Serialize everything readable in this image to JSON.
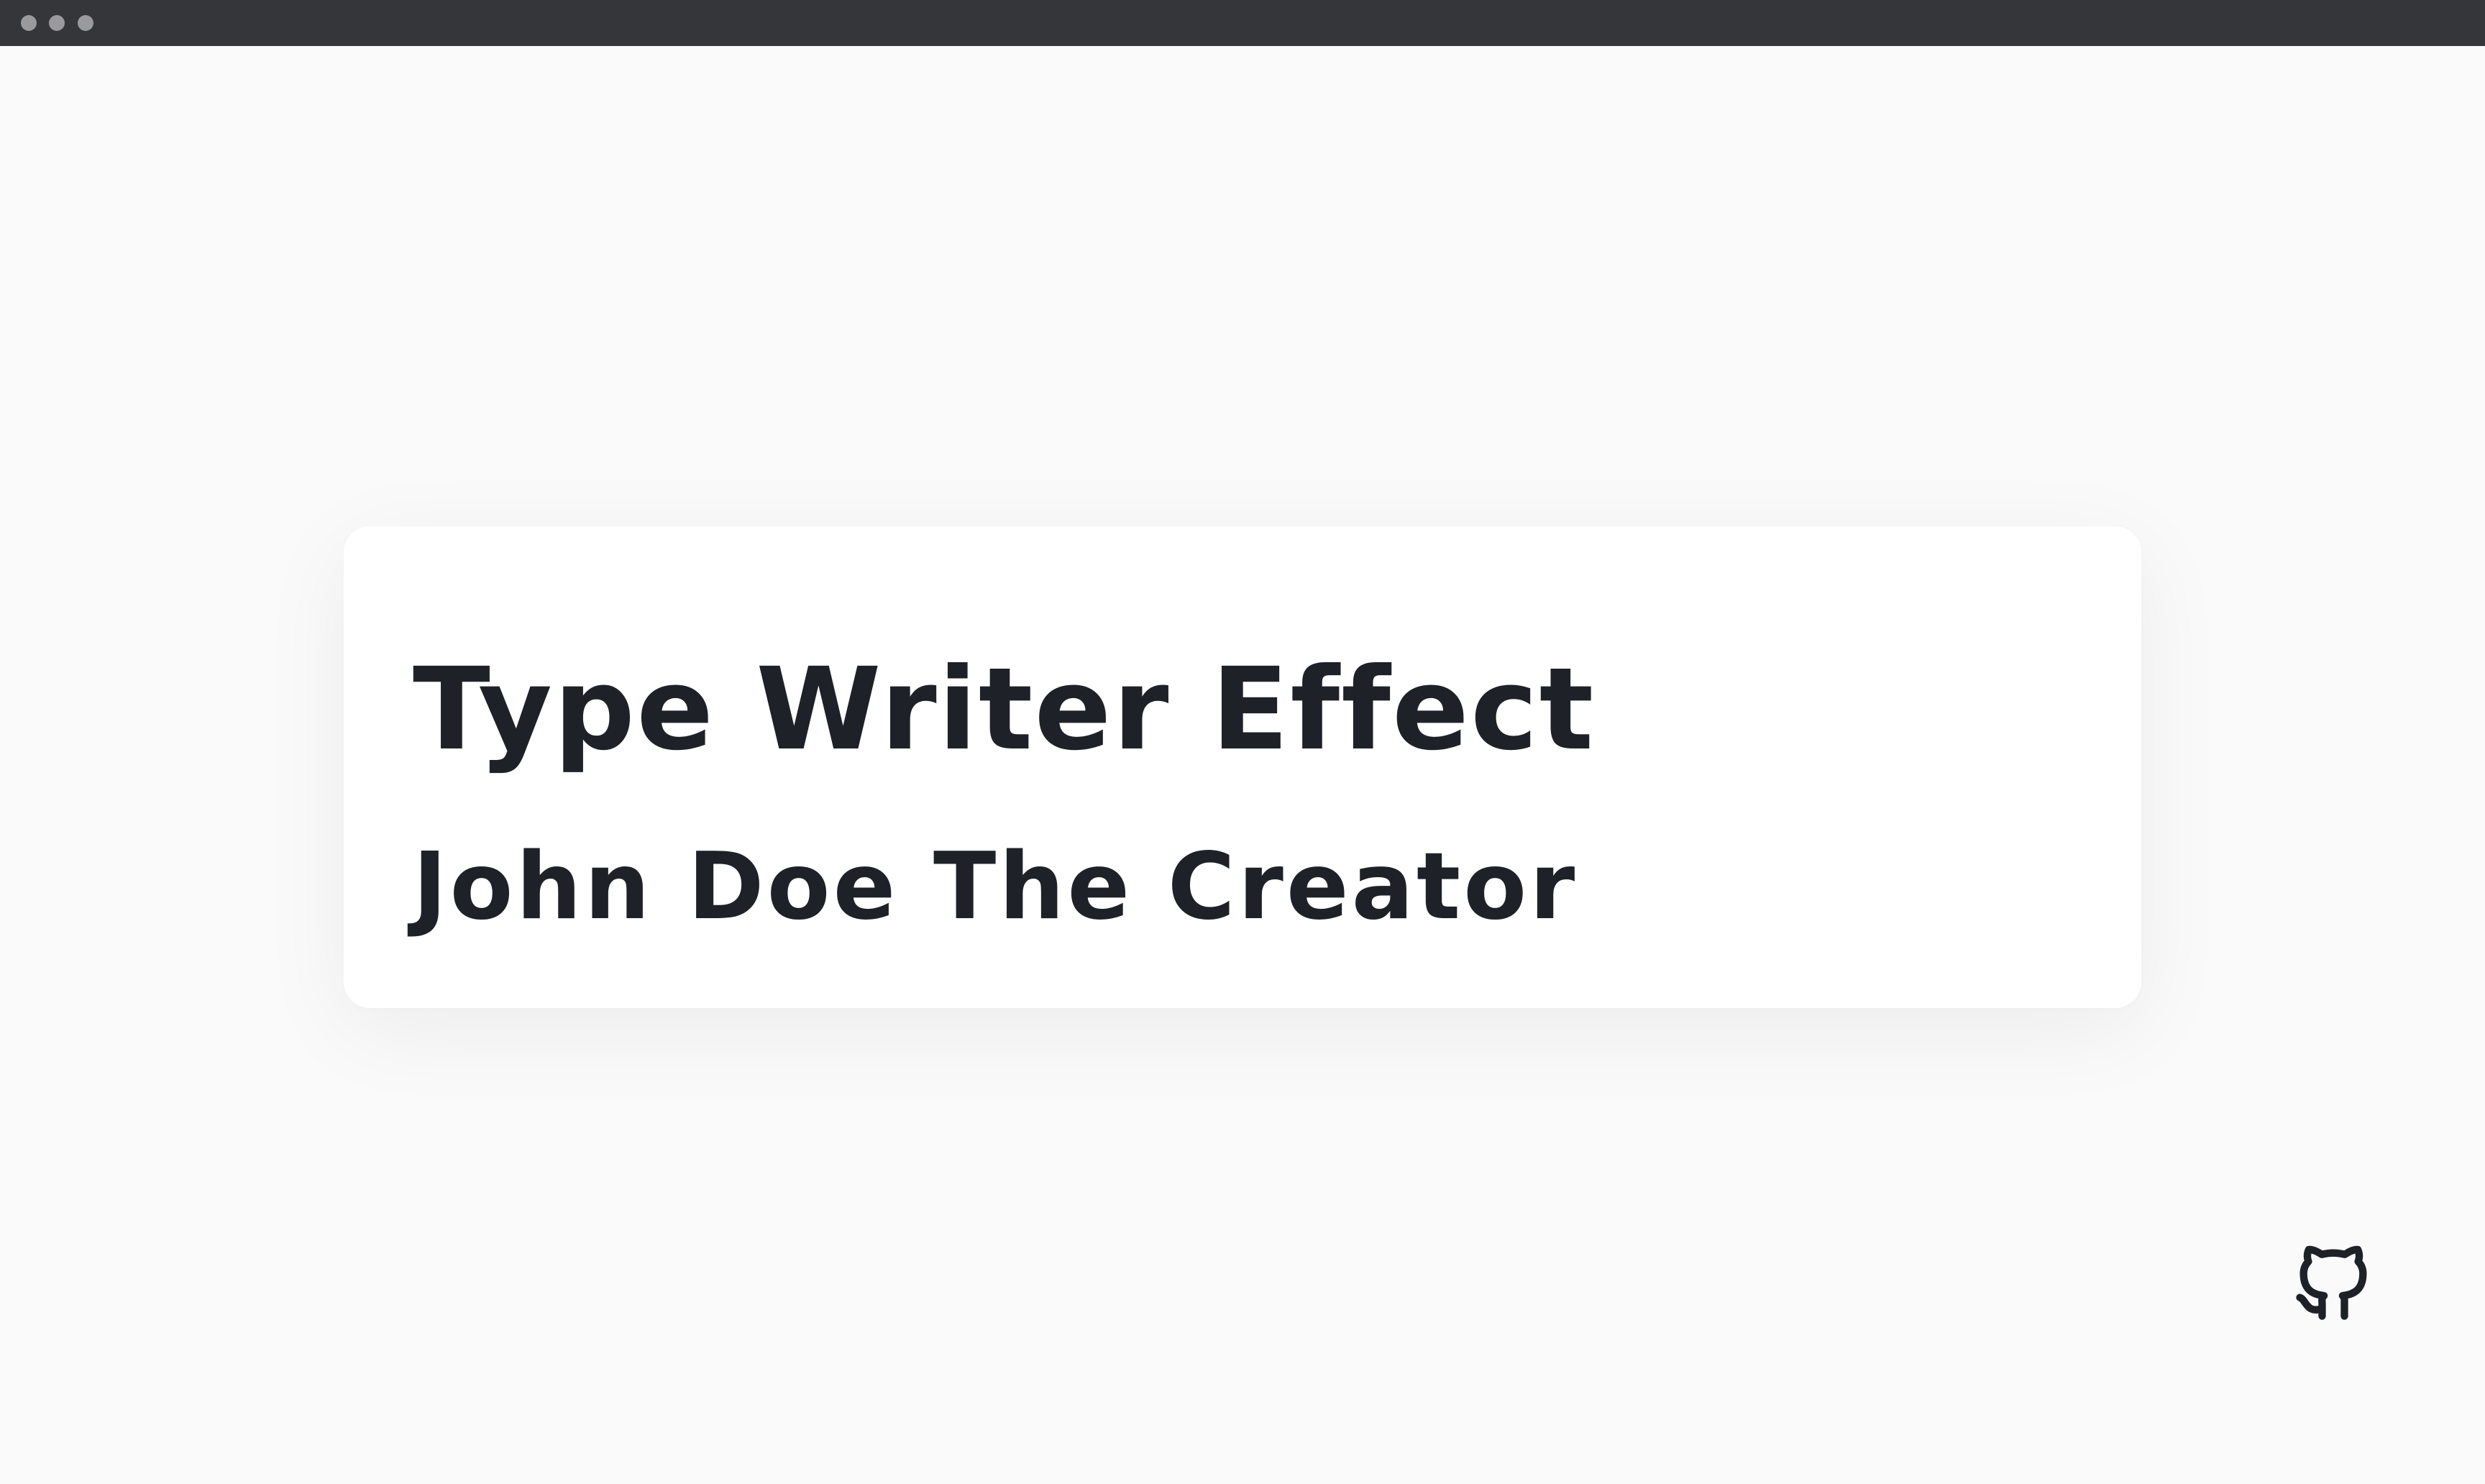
{
  "card": {
    "title": "Type Writer Effect",
    "subtitle": "John Doe The Creator"
  },
  "github": {
    "icon": "github-icon",
    "color": "#1e2228"
  },
  "colors": {
    "titlebar": "#35363a",
    "titlebar_dots": "#9a9a9c",
    "page_background": "#fafafa",
    "card_background": "#ffffff",
    "text": "#1e2228"
  }
}
